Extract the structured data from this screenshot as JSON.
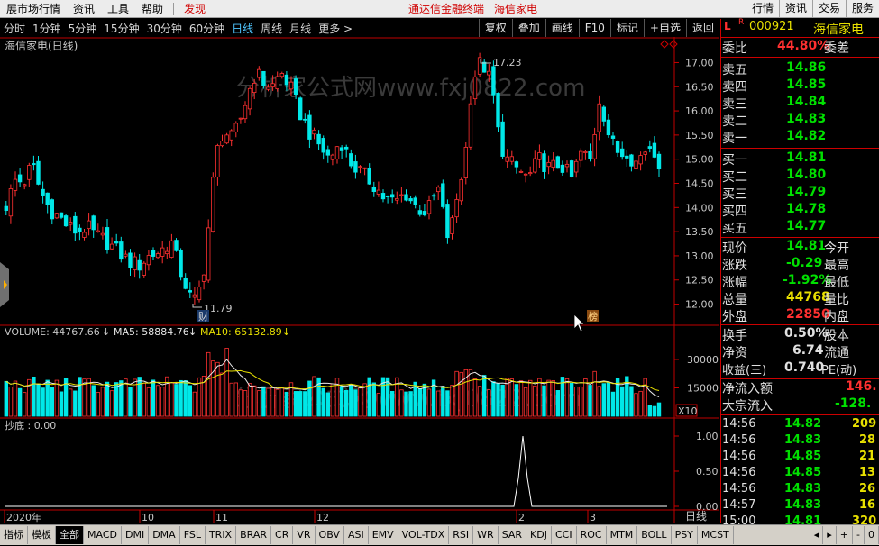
{
  "menu": {
    "items": [
      "展市场行情",
      "资讯",
      "工具",
      "帮助"
    ],
    "discover": "发现",
    "center_text": "通达信金融终端",
    "center_stock": "海信家电",
    "right_buttons": [
      "行情",
      "资讯",
      "交易",
      "服务"
    ]
  },
  "periods": [
    "分时",
    "1分钟",
    "5分钟",
    "15分钟",
    "30分钟",
    "60分钟",
    "日线",
    "周线",
    "月线",
    "更多 >"
  ],
  "active_period": "日线",
  "toolbar": [
    "复权",
    "叠加",
    "画线",
    "F10",
    "标记",
    "+自选",
    "返回"
  ],
  "chart": {
    "title": "海信家电(日线)",
    "watermark": "分析家公式网www.fxj0822.com",
    "high_label": "17.23",
    "low_label": "11.79",
    "low_tag": "财",
    "rank_tag": "榜",
    "price_axis": [
      "17.00",
      "16.50",
      "16.00",
      "15.50",
      "15.00",
      "14.50",
      "14.00",
      "13.50",
      "13.00",
      "12.50",
      "12.00"
    ],
    "volume_header": {
      "volume": "VOLUME: 44767.66",
      "ma5": "MA5: 58884.76",
      "ma10": "MA10: 65132.89"
    },
    "volume_axis": [
      "30000",
      "15000"
    ],
    "volume_unit": "X10",
    "indicator_header": "抄底 : 0.00",
    "indicator_axis": [
      "1.00",
      "0.50",
      "0.00"
    ],
    "date_labels": [
      "2020年",
      "10",
      "11",
      "12",
      "2",
      "3"
    ],
    "date_corner": "日线"
  },
  "chart_data": {
    "type": "candlestick",
    "title": "海信家电(日线)",
    "ylim": [
      11.6,
      17.4
    ],
    "price_ticks": [
      12.0,
      12.5,
      13.0,
      13.5,
      14.0,
      14.5,
      15.0,
      15.5,
      16.0,
      16.5,
      17.0
    ],
    "high": 17.23,
    "low": 11.79,
    "up_color": "#ff3030",
    "down_color": "#00e8e8",
    "volume": {
      "last": 44767.66,
      "ma5": 58884.76,
      "ma10": 65132.89,
      "ylim": [
        0,
        40000
      ],
      "unit": "X10"
    },
    "indicator": {
      "name": "抄底",
      "last": 0.0,
      "ylim": [
        0,
        1.0
      ]
    }
  },
  "bottom_tabs": [
    "指标",
    "模板",
    "全部",
    "MACD",
    "DMI",
    "DMA",
    "FSL",
    "TRIX",
    "BRAR",
    "CR",
    "VR",
    "OBV",
    "ASI",
    "EMV",
    "VOL-TDX",
    "RSI",
    "WR",
    "SAR",
    "KDJ",
    "CCI",
    "ROC",
    "MTM",
    "BOLL",
    "PSY",
    "MCST"
  ],
  "bottom_controls": [
    "◂",
    "▸",
    "+",
    "-",
    "0"
  ],
  "quote": {
    "marker": "L",
    "marker2": "R",
    "code": "000921",
    "name": "海信家电",
    "weibi_label": "委比",
    "weibi_value": "44.80%",
    "weicha_label": "委差",
    "asks": [
      {
        "label": "卖五",
        "price": "14.86"
      },
      {
        "label": "卖四",
        "price": "14.85"
      },
      {
        "label": "卖三",
        "price": "14.84"
      },
      {
        "label": "卖二",
        "price": "14.83"
      },
      {
        "label": "卖一",
        "price": "14.82"
      }
    ],
    "bids": [
      {
        "label": "买一",
        "price": "14.81"
      },
      {
        "label": "买二",
        "price": "14.80"
      },
      {
        "label": "买三",
        "price": "14.79"
      },
      {
        "label": "买四",
        "price": "14.78"
      },
      {
        "label": "买五",
        "price": "14.77"
      }
    ],
    "stats": [
      {
        "label": "现价",
        "value": "14.81",
        "label2": "今开",
        "color": "green"
      },
      {
        "label": "涨跌",
        "value": "-0.29",
        "label2": "最高",
        "color": "green"
      },
      {
        "label": "涨幅",
        "value": "-1.92%",
        "label2": "最低",
        "color": "green"
      },
      {
        "label": "总量",
        "value": "44768",
        "label2": "量比",
        "color": "yellow"
      },
      {
        "label": "外盘",
        "value": "22850",
        "label2": "内盘",
        "color": "red"
      }
    ],
    "stats2": [
      {
        "label": "换手",
        "value": "0.50%",
        "label2": "股本"
      },
      {
        "label": "净资",
        "value": "6.74",
        "label2": "流通"
      },
      {
        "label": "收益(三)",
        "value": "0.740",
        "label2": "PE(动)"
      }
    ],
    "flows": [
      {
        "label": "净流入额",
        "value": "146."
      },
      {
        "label": "大宗流入",
        "value": "-128."
      }
    ],
    "ticks": [
      {
        "time": "14:56",
        "price": "14.82",
        "vol": "209"
      },
      {
        "time": "14:56",
        "price": "14.83",
        "vol": "28"
      },
      {
        "time": "14:56",
        "price": "14.85",
        "vol": "21"
      },
      {
        "time": "14:56",
        "price": "14.85",
        "vol": "13"
      },
      {
        "time": "14:56",
        "price": "14.83",
        "vol": "26"
      },
      {
        "time": "14:57",
        "price": "14.83",
        "vol": "16"
      },
      {
        "time": "15:00",
        "price": "14.81",
        "vol": "320"
      }
    ]
  }
}
